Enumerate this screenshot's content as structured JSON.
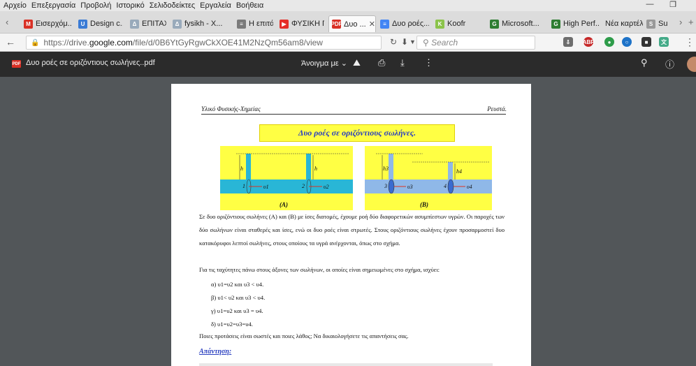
{
  "menubar": {
    "items": [
      "Αρχείο",
      "Επεξεργασία",
      "Προβολή",
      "Ιστορικό",
      "Σελιδοδείκτες",
      "Εργαλεία",
      "Βοήθεια"
    ]
  },
  "tabs": [
    {
      "label": "Εισερχόμ...",
      "icon": "gmail-icon",
      "color": "#d93025",
      "glyph": "M"
    },
    {
      "label": "Design c...",
      "icon": "design-icon",
      "color": "#3a7bd5",
      "glyph": "U"
    },
    {
      "label": "ΕΠΙΤΑΧΥ...",
      "icon": "drive-icon",
      "color": "#9ab",
      "glyph": "Δ"
    },
    {
      "label": "fysikh - X...",
      "icon": "drive-icon",
      "color": "#9ab",
      "glyph": "Δ"
    },
    {
      "label": "Η επιτάχ...",
      "icon": "slides-icon",
      "color": "#7a7a7a",
      "glyph": "≡"
    },
    {
      "label": "ΦΥΣΙΚΗ Γ...",
      "icon": "youtube-icon",
      "color": "#e52d27",
      "glyph": "▶"
    },
    {
      "label": "Δυο ...",
      "icon": "pdf-icon",
      "color": "#d93025",
      "glyph": "PDF",
      "active": true
    },
    {
      "label": "Δυο ροές...",
      "icon": "docs-icon",
      "color": "#4285f4",
      "glyph": "≡"
    },
    {
      "label": "Koofr",
      "icon": "koofr-icon",
      "color": "#8bc34a",
      "glyph": "K"
    },
    {
      "label": "Microsoft...",
      "icon": "microsoft-icon",
      "color": "#2e7d32",
      "glyph": "G"
    },
    {
      "label": "High Perf...",
      "icon": "highperf-icon",
      "color": "#2e7d32",
      "glyph": "G"
    },
    {
      "label": "Νέα καρτέλα",
      "icon": "",
      "color": "",
      "glyph": ""
    },
    {
      "label": "SubzT",
      "icon": "subz-icon",
      "color": "#999",
      "glyph": "S"
    }
  ],
  "nav": {
    "url_prefix": "https://drive.",
    "url_domain": "google.com",
    "url_suffix": "/file/d/0B6YtGyRgwCkXOE41M2NzQm56am8/view",
    "search_placeholder": "Search"
  },
  "viewer": {
    "filename": "Δυο ροές σε οριζόντιους σωλήνες..pdf",
    "open_with": "Άνοιγμα με"
  },
  "document": {
    "header_left": "Υλικό Φυσικής-Χημείας",
    "header_right": "Ρευστά.",
    "title": "Δυο ροές σε οριζόντιους σωλήνες.",
    "figure": {
      "label_a": "(A)",
      "label_b": "(B)",
      "h": "h",
      "h3": "h3",
      "h4": "h4",
      "n1": "1",
      "n2": "2",
      "n3": "3",
      "n4": "4",
      "u1": "υ1",
      "u2": "υ2",
      "u3": "υ3",
      "u4": "υ4"
    },
    "paragraph1": "Σε δυο οριζόντιους σωλήνες (Α) και (Β) με ίσες διατομές, έχουμε ροή δύο διαφορετικών ασυμπίεστων υγρών. Οι παροχές των δύο σωλήνων είναι σταθερές και ίσες, ενώ οι δυο ροές είναι στρωτές. Στους οριζόντιους σωλήνες έχουν προσαρμοστεί δυο κατακόρυφοι λεπτοί σωλήνες, στους οποίους τα υγρά ανέρχονται, όπως στο σχήμα.",
    "paragraph2": "Για τις ταχύτητες πάνω στους άξονες των σωλήνων, οι οποίες είναι σημειωμένες στο σχήμα, ισχύει:",
    "options": [
      "α) υ1=υ2 και υ3 < υ4.",
      "β) υ1< υ2 και υ3 < υ4.",
      "γ) υ1=υ2 και υ3 = υ4.",
      "δ) υ1=υ2=υ3=υ4."
    ],
    "question": "Ποιες  προτάσεις είναι σωστές και ποιες λάθος; Να δικαιολογήσετε τις απαντήσεις σας.",
    "answer_heading": "Απάντηση:"
  }
}
